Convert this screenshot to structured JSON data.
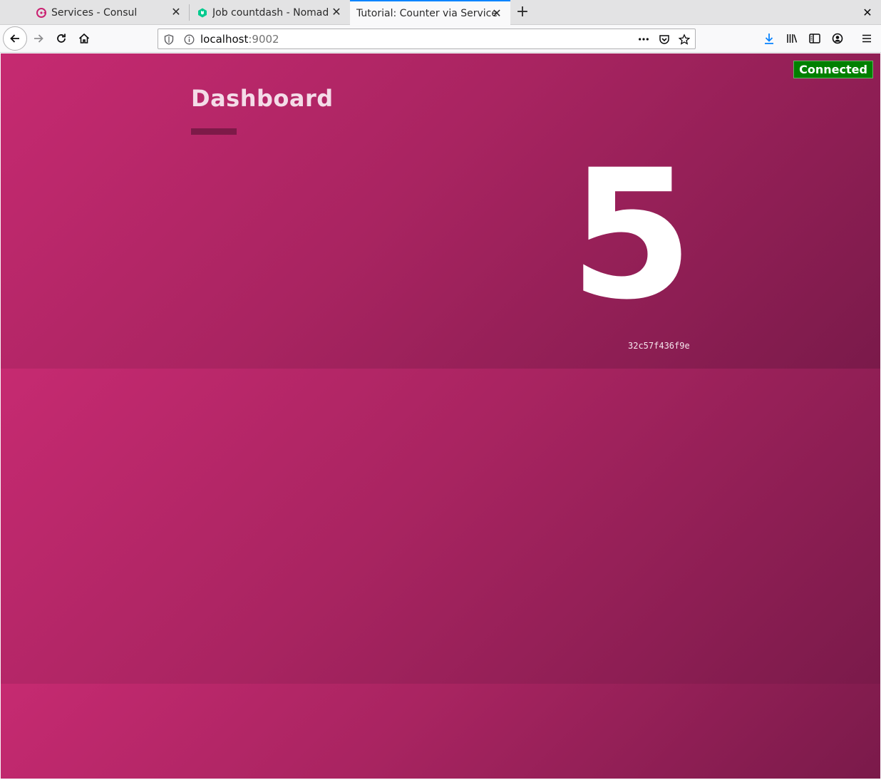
{
  "browser": {
    "tabs": [
      {
        "title": "Services - Consul",
        "icon": "consul-icon",
        "active": false
      },
      {
        "title": "Job countdash - Nomad",
        "icon": "nomad-icon",
        "active": false
      },
      {
        "title": "Tutorial: Counter via Service",
        "icon": "",
        "active": true
      }
    ],
    "url": {
      "host": "localhost",
      "port": ":9002"
    }
  },
  "page": {
    "status_badge": "Connected",
    "title": "Dashboard",
    "counter_value": "5",
    "instance_id": "32c57f436f9e"
  },
  "colors": {
    "background_start": "#c62a71",
    "background_end": "#7a1a4a",
    "status_green": "#008000",
    "accent_bar": "#7d1a48"
  }
}
